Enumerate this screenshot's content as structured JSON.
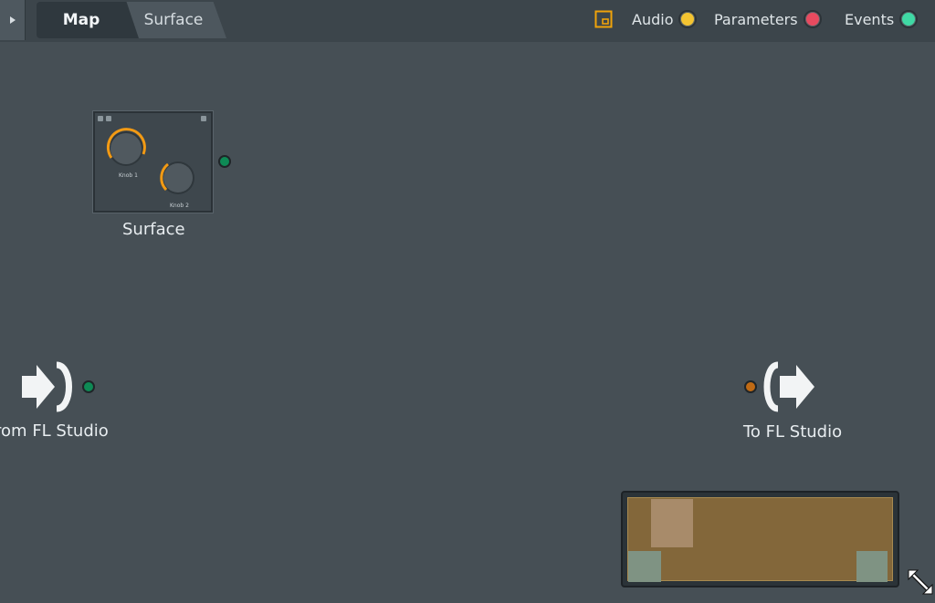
{
  "tabs": {
    "map": "Map",
    "surface": "Surface"
  },
  "legend": {
    "audio": "Audio",
    "parameters": "Parameters",
    "events": "Events"
  },
  "nodes": {
    "surface": {
      "label": "Surface",
      "knob1_label": "Knob 1",
      "knob2_label": "Knob 2"
    },
    "from_fl": {
      "label": "From FL Studio"
    },
    "to_fl": {
      "label": "To FL Studio"
    }
  },
  "colors": {
    "audio": "#f4c431",
    "parameters": "#e84a5f",
    "events": "#3fd9a4",
    "event_port": "#0e8a55",
    "audio_port": "#c06a14",
    "knob_accent": "#f29a14",
    "accent_icon": "#f0a30a"
  }
}
